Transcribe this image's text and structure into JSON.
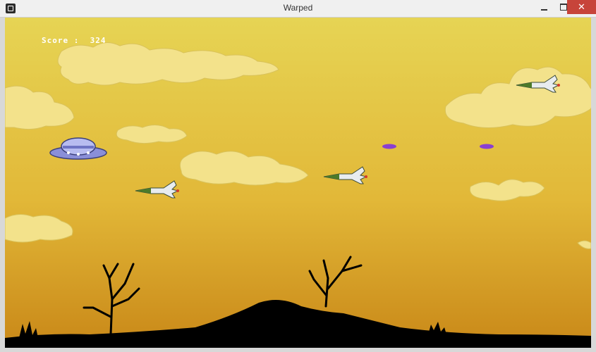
{
  "window": {
    "title": "Warped",
    "controls": [
      "minimize",
      "maximize",
      "close"
    ]
  },
  "hud": {
    "score_label": "Score :",
    "score_value": "324"
  },
  "scene": {
    "sky_top": "#e6d254",
    "sky_bottom": "#c98b19",
    "cloud_color": "#f3e28b",
    "silhouette_color": "#000000",
    "projectile_color": "#8a3fd1"
  },
  "entities": {
    "player": "ufo-saucer",
    "enemies": [
      "jet-fighter",
      "jet-fighter",
      "jet-fighter"
    ],
    "projectiles": [
      "purple-bullet",
      "purple-bullet"
    ]
  }
}
